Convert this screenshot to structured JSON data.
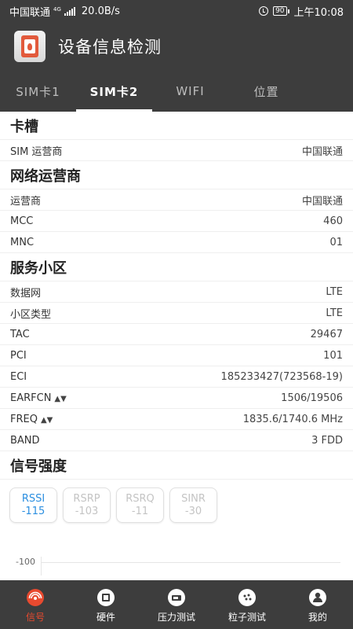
{
  "status_bar": {
    "carrier": "中国联通",
    "network": "4G",
    "speed": "20.0B/s",
    "battery": "90",
    "time": "上午10:08"
  },
  "app": {
    "title": "设备信息检测"
  },
  "tabs": [
    {
      "label": "SIM卡1",
      "active": false
    },
    {
      "label": "SIM卡2",
      "active": true
    },
    {
      "label": "WIFI",
      "active": false
    },
    {
      "label": "位置",
      "active": false
    }
  ],
  "sections": {
    "card_slot": {
      "title": "卡槽",
      "rows": [
        {
          "label": "SIM 运营商",
          "value": "中国联通"
        }
      ]
    },
    "network_operator": {
      "title": "网络运营商",
      "rows": [
        {
          "label": "运营商",
          "value": "中国联通"
        },
        {
          "label": "MCC",
          "value": "460"
        },
        {
          "label": "MNC",
          "value": "01"
        }
      ]
    },
    "serving_cell": {
      "title": "服务小区",
      "rows": [
        {
          "label": "数据网",
          "value": "LTE"
        },
        {
          "label": "小区类型",
          "value": "LTE"
        },
        {
          "label": "TAC",
          "value": "29467"
        },
        {
          "label": "PCI",
          "value": "101"
        },
        {
          "label": "ECI",
          "value": "185233427(723568-19)"
        },
        {
          "label": "EARFCN",
          "value": "1506/19506"
        },
        {
          "label": "FREQ",
          "value": "1835.6/1740.6 MHz"
        },
        {
          "label": "BAND",
          "value": "3 FDD"
        }
      ]
    },
    "signal": {
      "title": "信号强度",
      "chips": [
        {
          "name": "RSSI",
          "value": "-115",
          "active": true
        },
        {
          "name": "RSRP",
          "value": "-103",
          "active": false
        },
        {
          "name": "RSRQ",
          "value": "-11",
          "active": false
        },
        {
          "name": "SINR",
          "value": "-30",
          "active": false
        }
      ],
      "graph_y_label": "-100"
    }
  },
  "sort_arrows": "▲▼",
  "bottom_nav": [
    {
      "label": "信号",
      "icon": "signal-icon",
      "active": true
    },
    {
      "label": "硬件",
      "icon": "hardware-icon",
      "active": false
    },
    {
      "label": "压力测试",
      "icon": "stress-test-icon",
      "active": false
    },
    {
      "label": "粒子测试",
      "icon": "particle-test-icon",
      "active": false
    },
    {
      "label": "我的",
      "icon": "profile-icon",
      "active": false
    }
  ],
  "colors": {
    "bar": "#3d3d3d",
    "accent": "#e84a2f",
    "chip_active": "#2c8fe0"
  }
}
